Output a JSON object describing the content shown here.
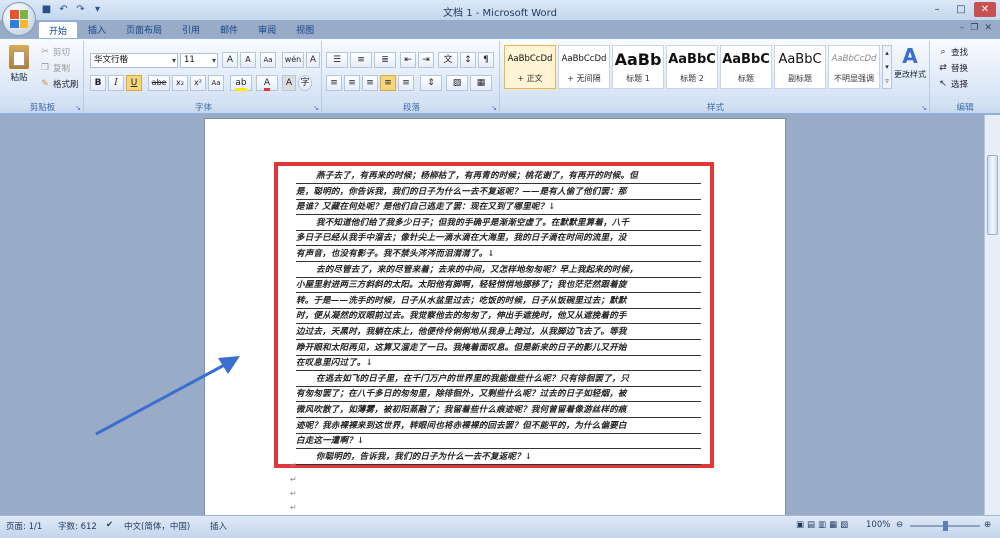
{
  "window": {
    "title": "文档 1 - Microsoft Word"
  },
  "tabs": [
    "开始",
    "插入",
    "页面布局",
    "引用",
    "邮件",
    "审阅",
    "视图"
  ],
  "clipboard": {
    "paste": "粘贴",
    "cut": "剪切",
    "copy": "复制",
    "format_painter": "格式刷",
    "label": "剪贴板"
  },
  "font": {
    "name": "华文行楷",
    "size": "11",
    "label": "字体",
    "grow": "A",
    "shrink": "A",
    "clear": "Aa",
    "bold": "B",
    "italic": "I",
    "underline": "U",
    "strike": "abe",
    "sub": "x₂",
    "sup": "x²",
    "case": "Aa",
    "color_a": "A"
  },
  "paragraph": {
    "label": "段落"
  },
  "styles": {
    "label": "样式",
    "items": [
      {
        "preview": "AaBbCcDd",
        "name": "+ 正文"
      },
      {
        "preview": "AaBbCcDd",
        "name": "+ 无间隔"
      },
      {
        "preview": "AaBb",
        "name": "标题 1"
      },
      {
        "preview": "AaBbC",
        "name": "标题 2"
      },
      {
        "preview": "AaBbC",
        "name": "标题"
      },
      {
        "preview": "AaBbC",
        "name": "副标题"
      },
      {
        "preview": "AaBbCcDd",
        "name": "不明显强调"
      }
    ],
    "change": "更改样式"
  },
  "editing": {
    "find": "查找",
    "replace": "替换",
    "select": "选择",
    "label": "编辑"
  },
  "document": {
    "lines": [
      "燕子去了，有再来的时候；杨柳枯了，有再青的时候；桃花谢了，有再开的时候。但",
      "是，聪明的，你告诉我，我们的日子为什么一去不复返呢？——是有人偷了他们罢：那",
      "是谁？又藏在何处呢？是他们自己逃走了罢：现在又到了哪里呢？↓",
      "我不知道他们给了我多少日子；但我的手确乎是渐渐空虚了。在默默里算着，八千",
      "多日子已经从我手中溜去；像针尖上一滴水滴在大海里，我的日子滴在时间的流里，没",
      "有声音，也没有影子。我不禁头涔涔而泪潸潸了。↓",
      "去的尽管去了，来的尽管来着；去来的中间，又怎样地匆匆呢？早上我起来的时候，",
      "小屋里射进两三方斜斜的太阳。太阳他有脚啊，轻轻悄悄地挪移了；我也茫茫然跟着旋",
      "转。于是——洗手的时候，日子从水盆里过去；吃饭的时候，日子从饭碗里过去；默默",
      "时，便从凝然的双眼前过去。我觉察他去的匆匆了，伸出手遮挽时，他又从遮挽着的手",
      "边过去，天黑时，我躺在床上，他便伶伶俐俐地从我身上跨过，从我脚边飞去了。等我",
      "睁开眼和太阳再见，这算又溜走了一日。我掩着面叹息。但是新来的日子的影儿又开始",
      "在叹息里闪过了。↓",
      "在逃去如飞的日子里，在千门万户的世界里的我能做些什么呢？只有徘徊罢了，只",
      "有匆匆罢了；在八千多日的匆匆里，除徘徊外，又剩些什么呢？过去的日子如轻烟，被",
      "微风吹散了，如薄雾，被初阳蒸融了；我留着些什么痕迹呢？我何曾留着像游丝样的痕",
      "迹呢？我赤裸裸来到这世界，转眼间也将赤裸裸的回去罢？但不能平的，为什么偏要白",
      "白走这一遭啊？↓",
      "你聪明的，告诉我，我们的日子为什么一去不复返呢？↓"
    ]
  },
  "status": {
    "page": "页面: 1/1",
    "words": "字数: 612",
    "lang": "中文(简体，中国)",
    "mode": "插入",
    "zoom": "100%"
  },
  "colors": {
    "accent": "#e0383a",
    "arrow": "#3a6ecf"
  }
}
